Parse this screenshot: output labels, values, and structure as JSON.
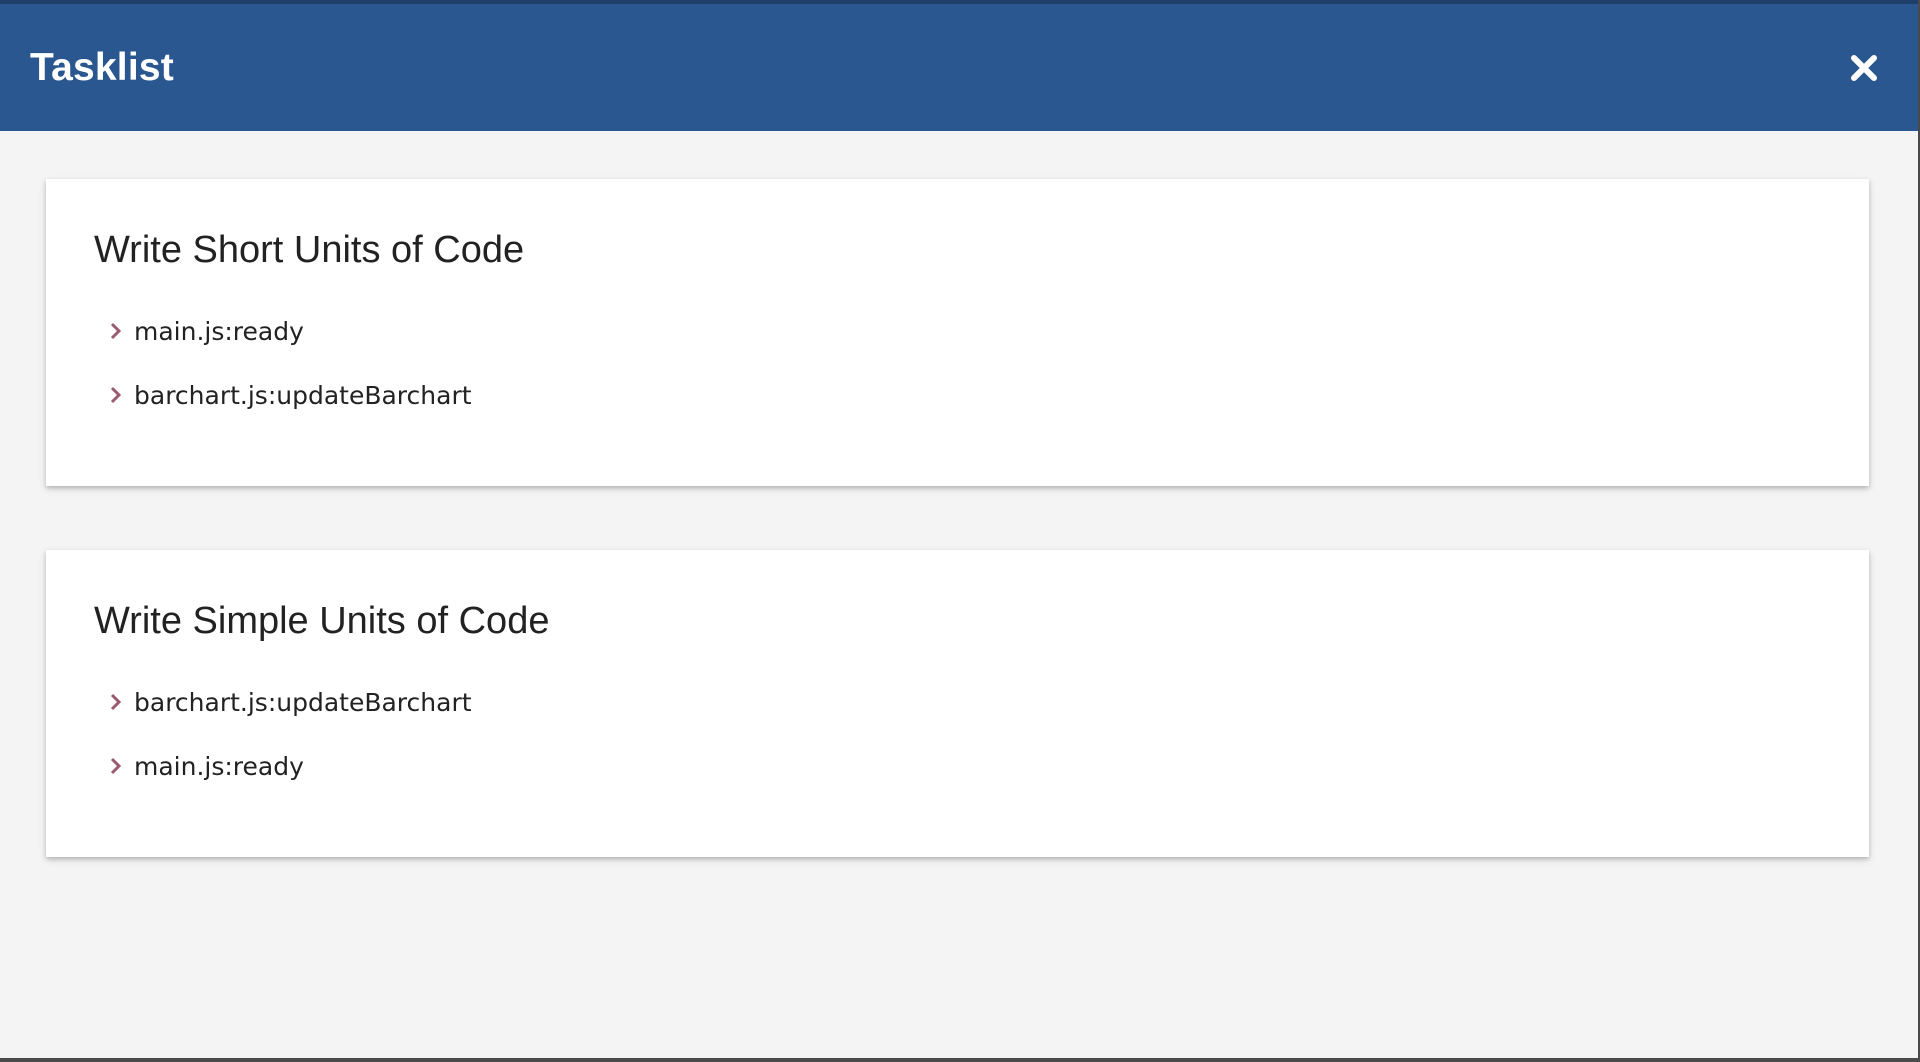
{
  "colors": {
    "header_bg": "#2b5790",
    "chevron": "#9a5a70"
  },
  "header": {
    "title": "Tasklist",
    "close_icon": "close-icon"
  },
  "cards": [
    {
      "title": "Write Short Units of Code",
      "items": [
        "main.js:ready",
        "barchart.js:updateBarchart"
      ]
    },
    {
      "title": "Write Simple Units of Code",
      "items": [
        "barchart.js:updateBarchart",
        "main.js:ready"
      ]
    }
  ]
}
